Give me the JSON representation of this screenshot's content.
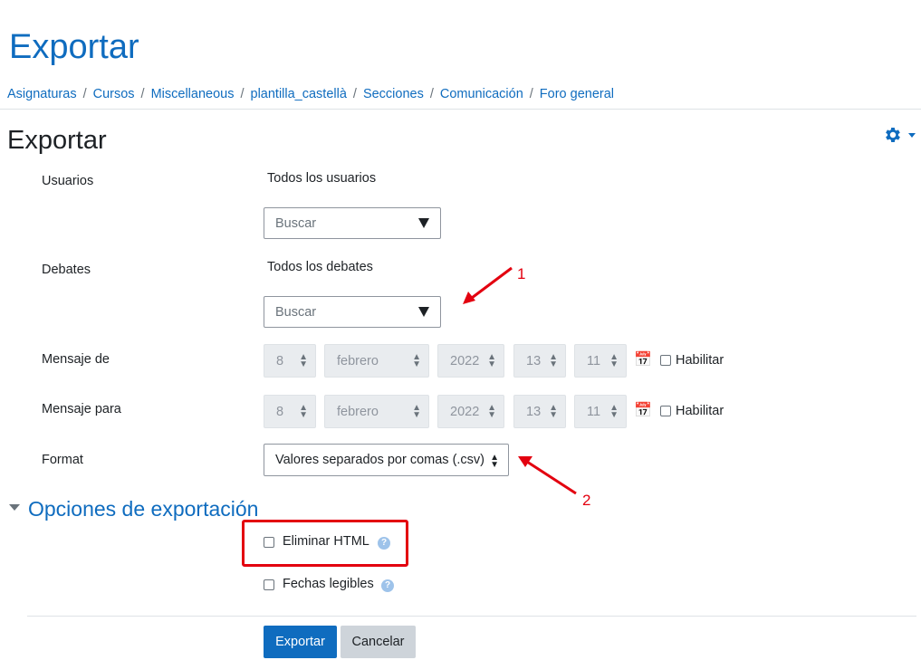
{
  "page": {
    "heading": "Exportar",
    "breadcrumb": [
      "Asignaturas",
      "Cursos",
      "Miscellaneous",
      "plantilla_castellà",
      "Secciones",
      "Comunicación",
      "Foro general"
    ],
    "breadcrumb_separator": "/",
    "subheading": "Exportar"
  },
  "form": {
    "users": {
      "label": "Usuarios",
      "value": "Todos los usuarios",
      "search_placeholder": "Buscar"
    },
    "discussions": {
      "label": "Debates",
      "value": "Todos los debates",
      "search_placeholder": "Buscar"
    },
    "from": {
      "label": "Mensaje de",
      "day": "8",
      "month": "febrero",
      "year": "2022",
      "hour": "13",
      "minute": "11",
      "enable_label": "Habilitar",
      "enabled": false
    },
    "to": {
      "label": "Mensaje para",
      "day": "8",
      "month": "febrero",
      "year": "2022",
      "hour": "13",
      "minute": "11",
      "enable_label": "Habilitar",
      "enabled": false
    },
    "format": {
      "label": "Format",
      "value": "Valores separados por comas (.csv)"
    }
  },
  "export_options": {
    "title": "Opciones de exportación",
    "remove_html": {
      "label": "Eliminar HTML",
      "checked": false
    },
    "readable_dates": {
      "label": "Fechas legibles",
      "checked": false
    }
  },
  "buttons": {
    "submit": "Exportar",
    "cancel": "Cancelar"
  },
  "annotations": {
    "arrow1": "1",
    "arrow2": "2",
    "color": "#e3000f"
  },
  "colors": {
    "brand": "#0f6cbf",
    "annotation_red": "#e3000f"
  },
  "icons": {
    "settings": "gear-icon",
    "calendar": "calendar-icon",
    "help": "help-icon"
  }
}
